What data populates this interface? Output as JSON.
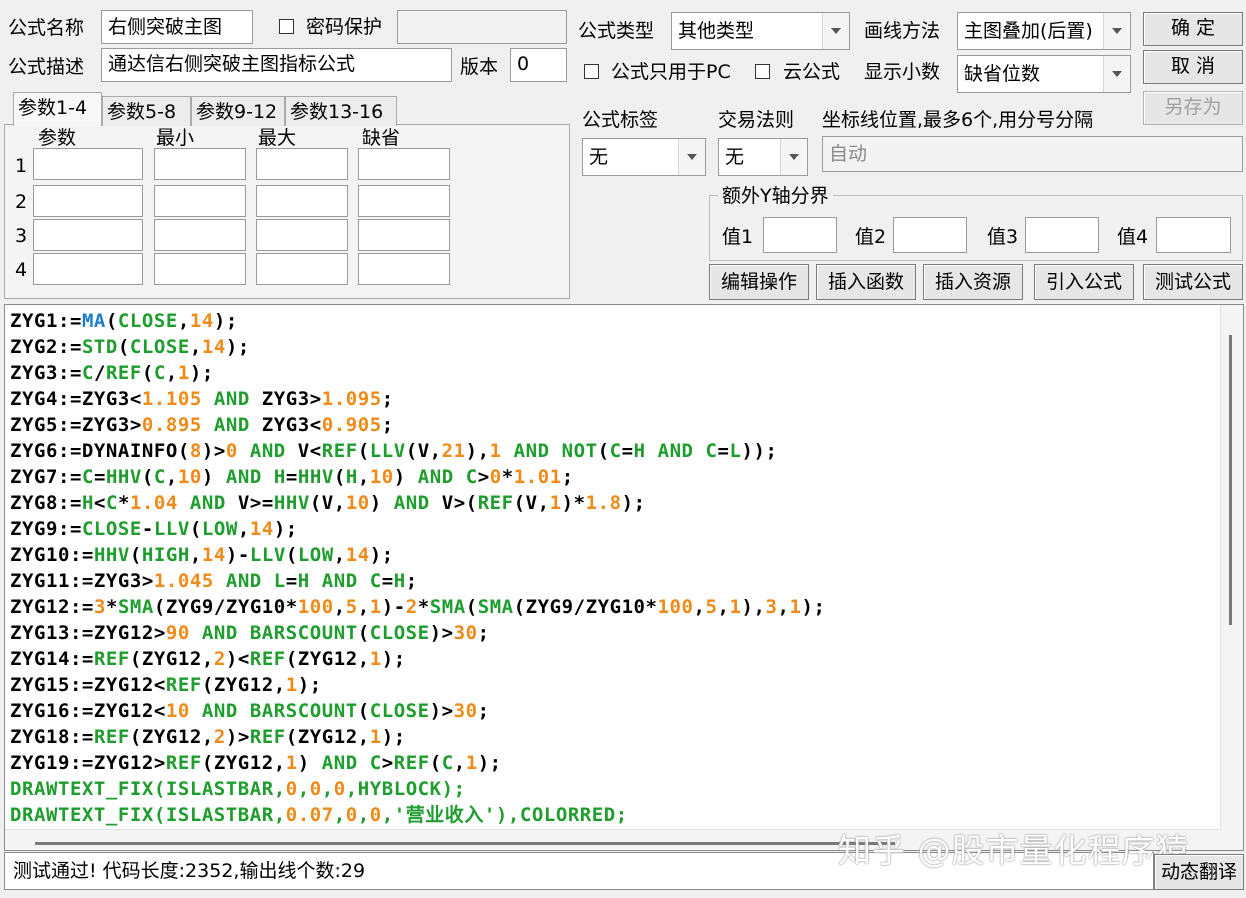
{
  "formula": {
    "name_label": "公式名称",
    "name_value": "右侧突破主图",
    "password_label": "密码保护",
    "desc_label": "公式描述",
    "desc_value": "通达信右侧突破主图指标公式",
    "version_label": "版本",
    "version_value": "0",
    "type_label": "公式类型",
    "type_value": "其他类型",
    "pc_only_label": "公式只用于PC",
    "cloud_label": "云公式",
    "draw_method_label": "画线方法",
    "draw_method_value": "主图叠加(后置)",
    "decimals_label": "显示小数",
    "decimals_value": "缺省位数"
  },
  "buttons": {
    "ok": "确  定",
    "cancel": "取  消",
    "save_as": "另存为",
    "edit_ops": "编辑操作",
    "insert_func": "插入函数",
    "insert_res": "插入资源",
    "import_formula": "引入公式",
    "test_formula": "测试公式",
    "dynamic_translate": "动态翻译"
  },
  "tabs": [
    "参数1-4",
    "参数5-8",
    "参数9-12",
    "参数13-16"
  ],
  "param_headers": [
    "参数",
    "最小",
    "最大",
    "缺省"
  ],
  "param_rows": [
    "1",
    "2",
    "3",
    "4"
  ],
  "tag_label": "公式标签",
  "tag_value": "无",
  "rule_label": "交易法则",
  "rule_value": "无",
  "axis_label": "坐标线位置,最多6个,用分号分隔",
  "axis_value": "自动",
  "yaxis": {
    "title": "额外Y轴分界",
    "labels": [
      "值1",
      "值2",
      "值3",
      "值4"
    ]
  },
  "code_lines": [
    [
      [
        "ZYG1:=",
        "v"
      ],
      [
        "MA",
        "c"
      ],
      [
        "(",
        "v"
      ],
      [
        "CLOSE",
        "f"
      ],
      [
        ",",
        "v"
      ],
      [
        "14",
        "n"
      ],
      [
        ");",
        "v"
      ]
    ],
    [
      [
        "ZYG2:=",
        "v"
      ],
      [
        "STD",
        "f"
      ],
      [
        "(",
        "v"
      ],
      [
        "CLOSE",
        "f"
      ],
      [
        ",",
        "v"
      ],
      [
        "14",
        "n"
      ],
      [
        ");",
        "v"
      ]
    ],
    [
      [
        "ZYG3:=",
        "v"
      ],
      [
        "C",
        "f"
      ],
      [
        "/",
        "v"
      ],
      [
        "REF",
        "f"
      ],
      [
        "(",
        "v"
      ],
      [
        "C",
        "f"
      ],
      [
        ",",
        "v"
      ],
      [
        "1",
        "n"
      ],
      [
        ");",
        "v"
      ]
    ],
    [
      [
        "ZYG4:=ZYG3<",
        "v"
      ],
      [
        "1.105",
        "n"
      ],
      [
        " ",
        "v"
      ],
      [
        "AND",
        "f"
      ],
      [
        " ZYG3>",
        "v"
      ],
      [
        "1.095",
        "n"
      ],
      [
        ";",
        "v"
      ]
    ],
    [
      [
        "ZYG5:=ZYG3>",
        "v"
      ],
      [
        "0.895",
        "n"
      ],
      [
        " ",
        "v"
      ],
      [
        "AND",
        "f"
      ],
      [
        " ZYG3<",
        "v"
      ],
      [
        "0.905",
        "n"
      ],
      [
        ";",
        "v"
      ]
    ],
    [
      [
        "ZYG6:=DYNAINFO(",
        "v"
      ],
      [
        "8",
        "n"
      ],
      [
        ")>",
        "v"
      ],
      [
        "0",
        "n"
      ],
      [
        " ",
        "v"
      ],
      [
        "AND",
        "f"
      ],
      [
        " V<",
        "v"
      ],
      [
        "REF",
        "f"
      ],
      [
        "(",
        "v"
      ],
      [
        "LLV",
        "f"
      ],
      [
        "(V,",
        "v"
      ],
      [
        "21",
        "n"
      ],
      [
        "),",
        "v"
      ],
      [
        "1",
        "n"
      ],
      [
        " ",
        "v"
      ],
      [
        "AND",
        "f"
      ],
      [
        " ",
        "v"
      ],
      [
        "NOT",
        "f"
      ],
      [
        "(",
        "v"
      ],
      [
        "C",
        "f"
      ],
      [
        "=",
        "v"
      ],
      [
        "H",
        "f"
      ],
      [
        " ",
        "v"
      ],
      [
        "AND",
        "f"
      ],
      [
        " ",
        "v"
      ],
      [
        "C",
        "f"
      ],
      [
        "=",
        "v"
      ],
      [
        "L",
        "f"
      ],
      [
        "));",
        "v"
      ]
    ],
    [
      [
        "ZYG7:=",
        "v"
      ],
      [
        "C",
        "f"
      ],
      [
        "=",
        "v"
      ],
      [
        "HHV",
        "f"
      ],
      [
        "(",
        "v"
      ],
      [
        "C",
        "f"
      ],
      [
        ",",
        "v"
      ],
      [
        "10",
        "n"
      ],
      [
        ") ",
        "v"
      ],
      [
        "AND",
        "f"
      ],
      [
        " ",
        "v"
      ],
      [
        "H",
        "f"
      ],
      [
        "=",
        "v"
      ],
      [
        "HHV",
        "f"
      ],
      [
        "(",
        "v"
      ],
      [
        "H",
        "f"
      ],
      [
        ",",
        "v"
      ],
      [
        "10",
        "n"
      ],
      [
        ") ",
        "v"
      ],
      [
        "AND",
        "f"
      ],
      [
        " ",
        "v"
      ],
      [
        "C",
        "f"
      ],
      [
        ">",
        "v"
      ],
      [
        "0",
        "n"
      ],
      [
        "*",
        "v"
      ],
      [
        "1.01",
        "n"
      ],
      [
        ";",
        "v"
      ]
    ],
    [
      [
        "ZYG8:=",
        "v"
      ],
      [
        "H",
        "f"
      ],
      [
        "<",
        "v"
      ],
      [
        "C",
        "f"
      ],
      [
        "*",
        "v"
      ],
      [
        "1.04",
        "n"
      ],
      [
        " ",
        "v"
      ],
      [
        "AND",
        "f"
      ],
      [
        " V>=",
        "v"
      ],
      [
        "HHV",
        "f"
      ],
      [
        "(V,",
        "v"
      ],
      [
        "10",
        "n"
      ],
      [
        ") ",
        "v"
      ],
      [
        "AND",
        "f"
      ],
      [
        " V>(",
        "v"
      ],
      [
        "REF",
        "f"
      ],
      [
        "(V,",
        "v"
      ],
      [
        "1",
        "n"
      ],
      [
        ")*",
        "v"
      ],
      [
        "1.8",
        "n"
      ],
      [
        ");",
        "v"
      ]
    ],
    [
      [
        "ZYG9:=",
        "v"
      ],
      [
        "CLOSE",
        "f"
      ],
      [
        "-",
        "v"
      ],
      [
        "LLV",
        "f"
      ],
      [
        "(",
        "v"
      ],
      [
        "LOW",
        "f"
      ],
      [
        ",",
        "v"
      ],
      [
        "14",
        "n"
      ],
      [
        ");",
        "v"
      ]
    ],
    [
      [
        "ZYG10:=",
        "v"
      ],
      [
        "HHV",
        "f"
      ],
      [
        "(",
        "v"
      ],
      [
        "HIGH",
        "f"
      ],
      [
        ",",
        "v"
      ],
      [
        "14",
        "n"
      ],
      [
        ")-",
        "v"
      ],
      [
        "LLV",
        "f"
      ],
      [
        "(",
        "v"
      ],
      [
        "LOW",
        "f"
      ],
      [
        ",",
        "v"
      ],
      [
        "14",
        "n"
      ],
      [
        ");",
        "v"
      ]
    ],
    [
      [
        "ZYG11:=ZYG3>",
        "v"
      ],
      [
        "1.045",
        "n"
      ],
      [
        " ",
        "v"
      ],
      [
        "AND",
        "f"
      ],
      [
        " ",
        "v"
      ],
      [
        "L",
        "f"
      ],
      [
        "=",
        "v"
      ],
      [
        "H",
        "f"
      ],
      [
        " ",
        "v"
      ],
      [
        "AND",
        "f"
      ],
      [
        " ",
        "v"
      ],
      [
        "C",
        "f"
      ],
      [
        "=",
        "v"
      ],
      [
        "H",
        "f"
      ],
      [
        ";",
        "v"
      ]
    ],
    [
      [
        "ZYG12:=",
        "v"
      ],
      [
        "3",
        "n"
      ],
      [
        "*",
        "v"
      ],
      [
        "SMA",
        "f"
      ],
      [
        "(ZYG9/ZYG10*",
        "v"
      ],
      [
        "100",
        "n"
      ],
      [
        ",",
        "v"
      ],
      [
        "5",
        "n"
      ],
      [
        ",",
        "v"
      ],
      [
        "1",
        "n"
      ],
      [
        ")-",
        "v"
      ],
      [
        "2",
        "n"
      ],
      [
        "*",
        "v"
      ],
      [
        "SMA",
        "f"
      ],
      [
        "(",
        "v"
      ],
      [
        "SMA",
        "f"
      ],
      [
        "(ZYG9/ZYG10*",
        "v"
      ],
      [
        "100",
        "n"
      ],
      [
        ",",
        "v"
      ],
      [
        "5",
        "n"
      ],
      [
        ",",
        "v"
      ],
      [
        "1",
        "n"
      ],
      [
        "),",
        "v"
      ],
      [
        "3",
        "n"
      ],
      [
        ",",
        "v"
      ],
      [
        "1",
        "n"
      ],
      [
        ");",
        "v"
      ]
    ],
    [
      [
        "ZYG13:=ZYG12>",
        "v"
      ],
      [
        "90",
        "n"
      ],
      [
        " ",
        "v"
      ],
      [
        "AND",
        "f"
      ],
      [
        " ",
        "v"
      ],
      [
        "BARSCOUNT",
        "f"
      ],
      [
        "(",
        "v"
      ],
      [
        "CLOSE",
        "f"
      ],
      [
        ")>",
        "v"
      ],
      [
        "30",
        "n"
      ],
      [
        ";",
        "v"
      ]
    ],
    [
      [
        "ZYG14:=",
        "v"
      ],
      [
        "REF",
        "f"
      ],
      [
        "(ZYG12,",
        "v"
      ],
      [
        "2",
        "n"
      ],
      [
        ")<",
        "v"
      ],
      [
        "REF",
        "f"
      ],
      [
        "(ZYG12,",
        "v"
      ],
      [
        "1",
        "n"
      ],
      [
        ");",
        "v"
      ]
    ],
    [
      [
        "ZYG15:=ZYG12<",
        "v"
      ],
      [
        "REF",
        "f"
      ],
      [
        "(ZYG12,",
        "v"
      ],
      [
        "1",
        "n"
      ],
      [
        ");",
        "v"
      ]
    ],
    [
      [
        "ZYG16:=ZYG12<",
        "v"
      ],
      [
        "10",
        "n"
      ],
      [
        " ",
        "v"
      ],
      [
        "AND",
        "f"
      ],
      [
        " ",
        "v"
      ],
      [
        "BARSCOUNT",
        "f"
      ],
      [
        "(",
        "v"
      ],
      [
        "CLOSE",
        "f"
      ],
      [
        ")>",
        "v"
      ],
      [
        "30",
        "n"
      ],
      [
        ";",
        "v"
      ]
    ],
    [
      [
        "ZYG18:=",
        "v"
      ],
      [
        "REF",
        "f"
      ],
      [
        "(ZYG12,",
        "v"
      ],
      [
        "2",
        "n"
      ],
      [
        ")>",
        "v"
      ],
      [
        "REF",
        "f"
      ],
      [
        "(ZYG12,",
        "v"
      ],
      [
        "1",
        "n"
      ],
      [
        ");",
        "v"
      ]
    ],
    [
      [
        "ZYG19:=ZYG12>",
        "v"
      ],
      [
        "REF",
        "f"
      ],
      [
        "(ZYG12,",
        "v"
      ],
      [
        "1",
        "n"
      ],
      [
        ") ",
        "v"
      ],
      [
        "AND",
        "f"
      ],
      [
        " ",
        "v"
      ],
      [
        "C",
        "f"
      ],
      [
        ">",
        "v"
      ],
      [
        "REF",
        "f"
      ],
      [
        "(",
        "v"
      ],
      [
        "C",
        "f"
      ],
      [
        ",",
        "v"
      ],
      [
        "1",
        "n"
      ],
      [
        ");",
        "v"
      ]
    ],
    [
      [
        "DRAWTEXT_FIX(ISLASTBAR,",
        "d"
      ],
      [
        "0",
        "n"
      ],
      [
        ",",
        "d"
      ],
      [
        "0",
        "n"
      ],
      [
        ",",
        "d"
      ],
      [
        "0",
        "n"
      ],
      [
        ",HYBLOCK);",
        "d"
      ]
    ],
    [
      [
        "DRAWTEXT_FIX(ISLASTBAR,",
        "d"
      ],
      [
        "0.07",
        "n"
      ],
      [
        ",",
        "d"
      ],
      [
        "0",
        "n"
      ],
      [
        ",",
        "d"
      ],
      [
        "0",
        "n"
      ],
      [
        ",'营业收入'),COLORRED;",
        "d"
      ]
    ]
  ],
  "status_text": "测试通过! 代码长度:2352,输出线个数:29",
  "watermark": "知乎 @股市量化程序猿",
  "colors": {
    "variable": "#000000",
    "function": "#1f9d2e",
    "number": "#f08a18",
    "ma": "#1d7fc8"
  }
}
